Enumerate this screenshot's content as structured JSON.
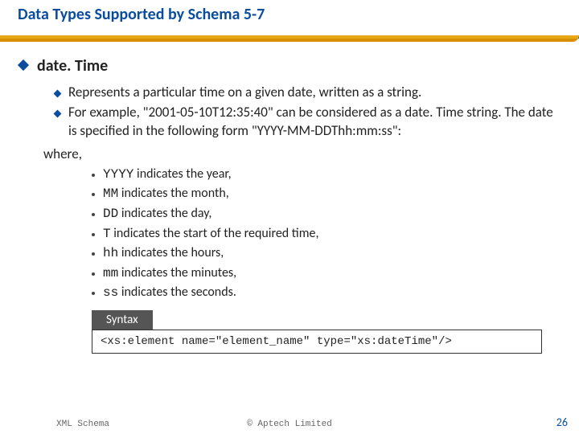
{
  "header": {
    "title": "Data Types Supported by Schema 5-7"
  },
  "main": {
    "heading": "date. Time",
    "points": [
      "Represents a particular time on a given date, written as a string.",
      "For example, \"2001-05-10T12:35:40\" can be considered as a date. Time string. The date is specified in the following form \"YYYY-MM-DDThh:mm:ss\":"
    ],
    "where_label": "where,",
    "parts": [
      {
        "code": "YYYY",
        "desc": " indicates the year,"
      },
      {
        "code": "MM",
        "desc": " indicates the month,"
      },
      {
        "code": "DD",
        "desc": " indicates the day,"
      },
      {
        "code": "T",
        "desc": " indicates the start of the required time,"
      },
      {
        "code": "hh",
        "desc": " indicates the hours,"
      },
      {
        "code": "mm",
        "desc": " indicates the minutes,"
      },
      {
        "code": "ss",
        "desc": " indicates the seconds."
      }
    ],
    "syntax_label": "Syntax",
    "syntax_code": "<xs:element name=\"element_name\" type=\"xs:dateTime\"/>"
  },
  "footer": {
    "left": "XML Schema",
    "center": "© Aptech Limited",
    "page": "26"
  }
}
